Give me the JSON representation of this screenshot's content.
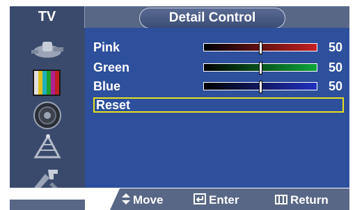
{
  "header": {
    "source_tab": "TV",
    "title": "Detail Control"
  },
  "sidebar": {
    "items": [
      {
        "icon": "input-icon"
      },
      {
        "icon": "picture-icon"
      },
      {
        "icon": "sound-icon"
      },
      {
        "icon": "channel-icon"
      },
      {
        "icon": "setup-icon"
      }
    ]
  },
  "settings": [
    {
      "label": "Pink",
      "value": "50",
      "level": 0.5,
      "color": "#c42020"
    },
    {
      "label": "Green",
      "value": "50",
      "level": 0.5,
      "color": "#0ea43a"
    },
    {
      "label": "Blue",
      "value": "50",
      "level": 0.5,
      "color": "#2030c0"
    }
  ],
  "reset": {
    "label": "Reset"
  },
  "help": {
    "move": "Move",
    "enter": "Enter",
    "return": "Return"
  },
  "colors": {
    "panel": "#2d4f9c",
    "sidebar": "#3a4a6c",
    "highlight": "#e8e020"
  }
}
